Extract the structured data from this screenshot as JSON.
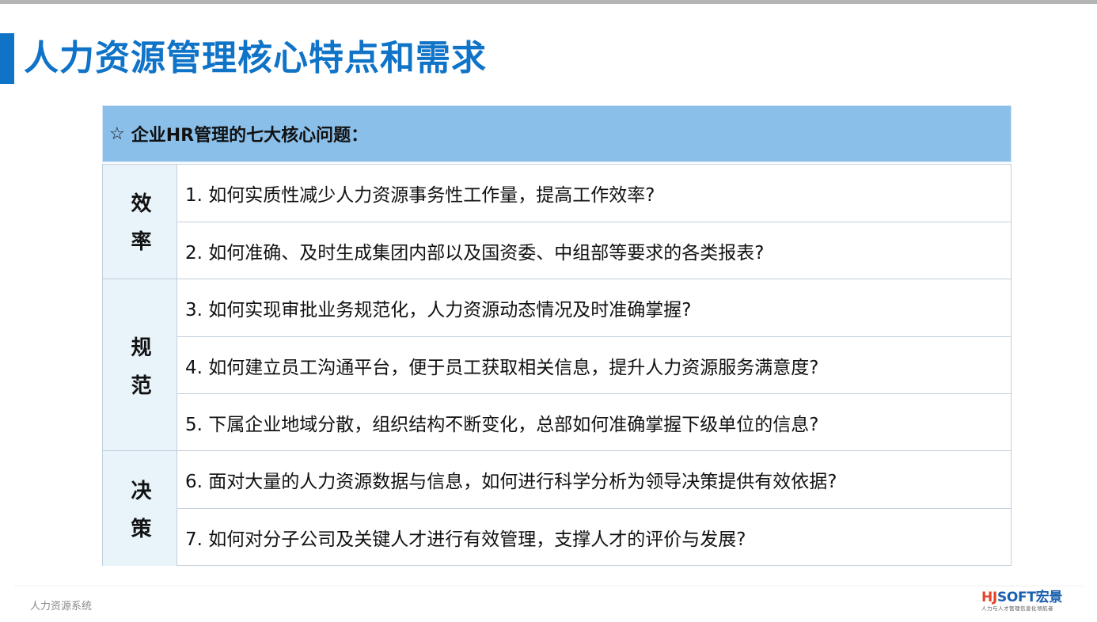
{
  "slide": {
    "title": "人力资源管理核心特点和需求"
  },
  "panel": {
    "header": {
      "icon": "☆",
      "text": "企业HR管理的七大核心问题："
    },
    "groups": [
      {
        "category": "效率",
        "questions": [
          "1.  如何实质性减少人力资源事务性工作量，提高工作效率?",
          "2.  如何准确、及时生成集团内部以及国资委、中组部等要求的各类报表?"
        ]
      },
      {
        "category": "规范",
        "questions": [
          "3.  如何实现审批业务规范化，人力资源动态情况及时准确掌握?",
          "4.  如何建立员工沟通平台，便于员工获取相关信息，提升人力资源服务满意度?",
          "5. 下属企业地域分散，组织结构不断变化，总部如何准确掌握下级单位的信息?"
        ]
      },
      {
        "category": "决策",
        "questions": [
          "6.  面对大量的人力资源数据与信息，如何进行科学分析为领导决策提供有效依据?",
          "7.  如何对分子公司及关键人才进行有效管理，支撑人才的评价与发展?"
        ]
      }
    ]
  },
  "footer": {
    "text": "人力资源系统",
    "logo": {
      "brand_hj": "HJ",
      "brand_soft": "SOFT宏景",
      "tagline": "人力与人才管理信息化领航者"
    }
  },
  "colors": {
    "accent": "#0f73c8",
    "header_bg": "#8abfea",
    "category_bg": "#e8f3fa",
    "border": "#c3cfdb"
  }
}
